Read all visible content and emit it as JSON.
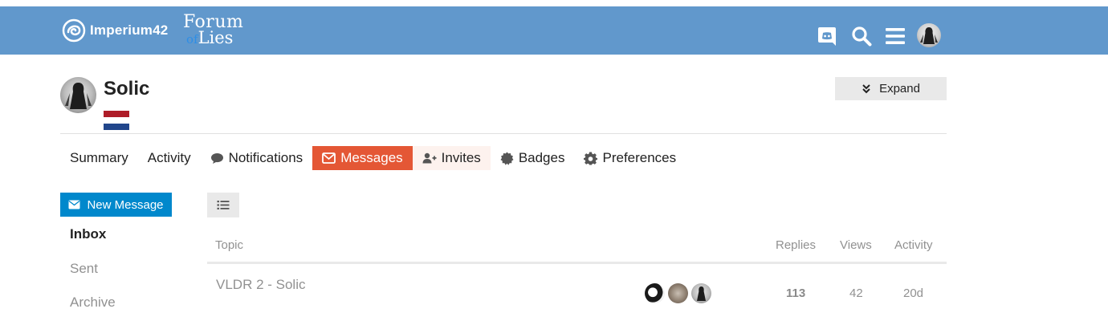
{
  "header": {
    "logo_text": "Imperium42",
    "forum_logo_line1": "Forum",
    "forum_logo_of": "of",
    "forum_logo_line2": "Lies",
    "icons": [
      "discord-icon",
      "search-icon",
      "hamburger-menu-icon",
      "user-avatar"
    ],
    "bar_color": "#6198cc"
  },
  "user": {
    "name": "Solic",
    "flag": "netherlands-flag",
    "expand_label": "Expand"
  },
  "nav": {
    "summary": "Summary",
    "activity": "Activity",
    "notifications": "Notifications",
    "messages": "Messages",
    "invites": "Invites",
    "badges": "Badges",
    "preferences": "Preferences",
    "active_color": "#e45735"
  },
  "sidebar": {
    "new_message": "New Message",
    "inbox": "Inbox",
    "sent": "Sent",
    "archive": "Archive",
    "button_color": "#0088cc"
  },
  "table": {
    "headers": {
      "topic": "Topic",
      "replies": "Replies",
      "views": "Views",
      "activity": "Activity"
    },
    "rows": [
      {
        "title": "VLDR 2 - Solic",
        "replies": "113",
        "views": "42",
        "activity": "20d"
      }
    ]
  }
}
